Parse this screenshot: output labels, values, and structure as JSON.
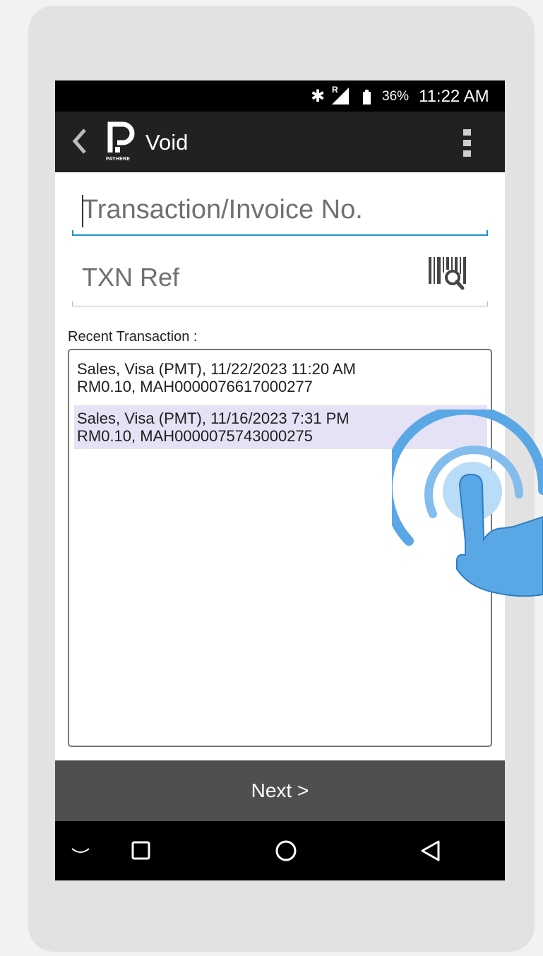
{
  "status_bar": {
    "bluetooth_icon": "bluetooth-icon",
    "signal_icon": "signal-icon",
    "signal_roaming": "R",
    "battery_icon": "battery-icon",
    "battery_percent": "36%",
    "time": "11:22 AM"
  },
  "app_bar": {
    "back_icon": "chevron-left-icon",
    "logo_text": "PAYHERE",
    "title": "Void",
    "menu_icon": "more-vertical-icon"
  },
  "form": {
    "invoice_placeholder": "Transaction/Invoice No.",
    "invoice_value": "",
    "txn_ref_placeholder": "TXN Ref",
    "txn_ref_value": "",
    "scan_icon": "barcode-scan-icon",
    "recent_label": "Recent Transaction :"
  },
  "transactions": [
    {
      "line1": "Sales, Visa (PMT), 11/22/2023 11:20 AM",
      "line2": "RM0.10, MAH0000076617000277",
      "selected": false
    },
    {
      "line1": "Sales, Visa (PMT), 11/16/2023 7:31 PM",
      "line2": "RM0.10, MAH0000075743000275",
      "selected": true
    }
  ],
  "next_button": "Next >",
  "nav_bar": {
    "items": [
      "chevron-down-icon",
      "recents-square-icon",
      "home-circle-icon",
      "back-triangle-icon"
    ]
  },
  "overlay": {
    "icon": "tap-hand-icon",
    "color": "#5aa7e6"
  }
}
